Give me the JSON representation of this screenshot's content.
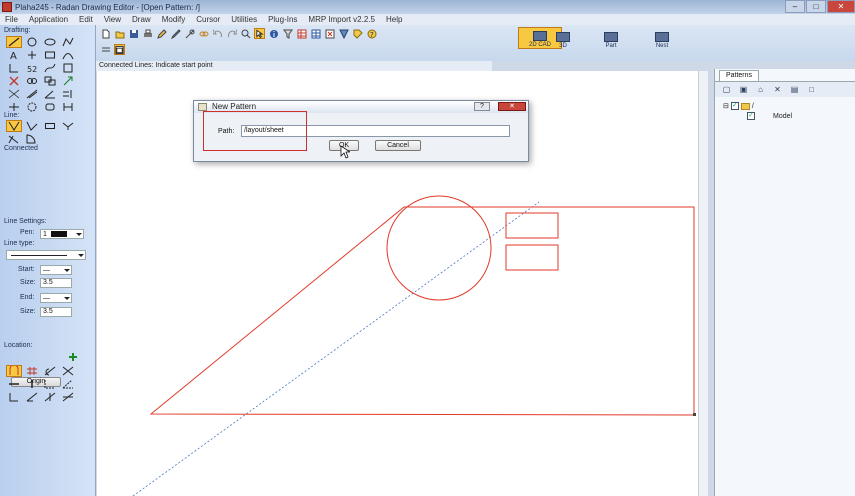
{
  "window": {
    "title": "Plaha245 - Radan Drawing Editor - [Open Pattern: /]",
    "controls": [
      "–",
      "□",
      "✕"
    ]
  },
  "menu": [
    "File",
    "Application",
    "Edit",
    "View",
    "Draw",
    "Modify",
    "Cursor",
    "Utilities",
    "Plug-Ins",
    "MRP Import v2.2.5",
    "Help"
  ],
  "left_panel": {
    "drafting_label": "Drafting:",
    "line_label": "Line:",
    "connected_label": "Connected",
    "line_settings_label": "Line Settings:",
    "pen_label": "Pen:",
    "pen_value": "1",
    "line_type_label": "Line type:",
    "start_label": "Start:",
    "start_value": "—",
    "start_size_label": "Size:",
    "start_size_value": "3.5",
    "end_label": "End:",
    "end_value": "—",
    "end_size_label": "Size:",
    "end_size_value": "3.5",
    "location_label": "Location:",
    "origin_button": "Origin"
  },
  "view_buttons": [
    {
      "label": "2D CAD",
      "active": true
    },
    {
      "label": "3D",
      "active": false
    },
    {
      "label": "Part",
      "active": false
    },
    {
      "label": "Nest",
      "active": false
    }
  ],
  "status": {
    "text": "Connected Lines: Indicate start point"
  },
  "right_panel": {
    "tab": "Patterns",
    "tree": [
      {
        "label": "/",
        "checked": true,
        "level": 0
      },
      {
        "label": "Model",
        "checked": true,
        "level": 1
      }
    ]
  },
  "dialog": {
    "title": "New Pattern",
    "help": "?",
    "close": "✕",
    "path_label": "Path:",
    "path_value": "/layout/sheet",
    "ok_label": "OK",
    "cancel_label": "Cancel"
  },
  "colors": {
    "drawing_lines": "#e23a2a",
    "construction_line": "#4a78c0",
    "active_tool": "#f8c840",
    "panel_bg": "#c7d8ee"
  }
}
